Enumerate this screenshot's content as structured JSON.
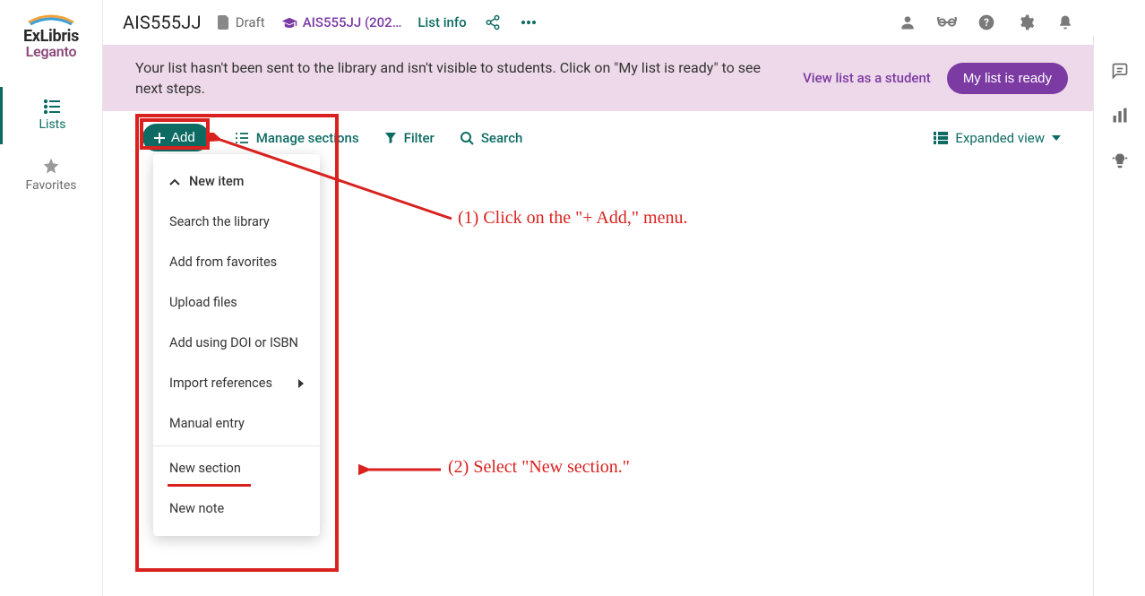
{
  "logo": {
    "line1": "ExLibris",
    "line2": "Leganto"
  },
  "leftnav": {
    "lists": "Lists",
    "favorites": "Favorites"
  },
  "topbar": {
    "list_title": "AIS555JJ",
    "draft_label": "Draft",
    "course_label": "AIS555JJ (202…",
    "list_info": "List info"
  },
  "banner": {
    "text": "Your list hasn't been sent to the library and isn't visible to students. Click on \"My list is ready\" to see next steps.",
    "view_as_student": "View list as a student",
    "my_list_ready": "My list is ready"
  },
  "toolbar": {
    "add": "Add",
    "manage_sections": "Manage sections",
    "filter": "Filter",
    "search": "Search",
    "expanded_view": "Expanded view"
  },
  "dropdown": {
    "new_item": "New item",
    "search_library": "Search the library",
    "add_from_favorites": "Add from favorites",
    "upload_files": "Upload files",
    "add_doi_isbn": "Add using DOI or ISBN",
    "import_refs": "Import references",
    "manual_entry": "Manual entry",
    "new_section": "New section",
    "new_note": "New note"
  },
  "annotations": {
    "step1": "(1) Click on the \"+ Add,\" menu.",
    "step2": "(2) Select \"New section.\""
  }
}
